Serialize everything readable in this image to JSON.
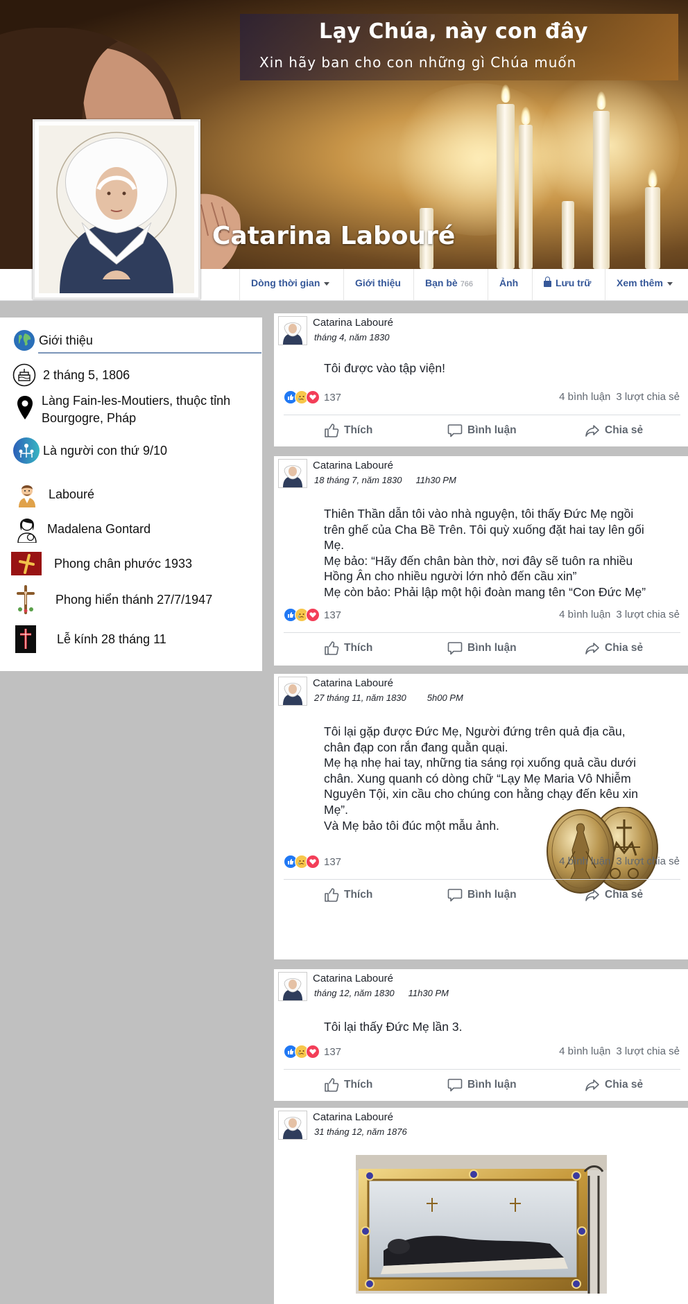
{
  "cover": {
    "title": "Lạy Chúa, này con đây",
    "subtitle": "Xin hãy ban cho con những gì Chúa muốn"
  },
  "profile": {
    "name": "Catarina Labouré"
  },
  "nav": {
    "timeline": "Dòng thời gian",
    "about": "Giới thiệu",
    "friends": "Bạn bè",
    "friends_count": "766",
    "photos": "Ảnh",
    "archive": "Lưu trữ",
    "more": "Xem thêm"
  },
  "intro": {
    "header": "Giới thiệu",
    "birthday": "2 tháng 5, 1806",
    "hometown": "Làng Fain-les-Moutiers, thuộc tỉnh Bourgogre, Pháp",
    "family_order": "Là người con thứ 9/10",
    "father": "Labouré",
    "mother": "Madalena Gontard",
    "beatified": "Phong chân phước 1933",
    "canonized": "Phong hiển thánh 27/7/1947",
    "feast": "Lễ kính 28 tháng 11"
  },
  "actions": {
    "like": "Thích",
    "comment": "Bình luận",
    "share": "Chia sẻ"
  },
  "posts": [
    {
      "author": "Catarina Labouré",
      "date": "tháng 4, năm 1830",
      "lines": [
        "Tôi được vào tập viện!"
      ],
      "reaction_count": "137",
      "comments": "4 bình luận",
      "shares": "3 lượt chia sẻ"
    },
    {
      "author": "Catarina Labouré",
      "date": "18 tháng 7, năm 1830",
      "time": "11h30 PM",
      "lines": [
        "Thiên Thần dẫn tôi vào nhà nguyện,  tôi thấy Đức Mẹ ngồi",
        "trên ghế của Cha Bề Trên. Tôi quỳ xuống đặt hai tay lên gối",
        "Mẹ.",
        "Mẹ bảo: “Hãy đến chân bàn thờ, nơi đây sẽ tuôn ra nhiều",
        "Hồng Ân cho nhiều người lớn nhỏ đến cầu xin”",
        "Mẹ còn bảo: Phải lập một hội đoàn mang tên “Con Đức Mẹ”"
      ],
      "reaction_count": "137",
      "comments": "4 bình luận",
      "shares": "3 lượt chia sẻ"
    },
    {
      "author": "Catarina Labouré",
      "date": "27 tháng 11, năm 1830",
      "time": "5h00 PM",
      "lines": [
        "Tôi lại gặp được Đức Mẹ, Người đứng trên quả địa cầu,",
        "chân đạp con rắn đang quằn quại.",
        "Mẹ hạ nhẹ hai tay, những tia sáng rọi xuống quả cầu dưới",
        "chân. Xung quanh có dòng chữ “Lạy Mẹ Maria Vô Nhiễm",
        "Nguyên Tội, xin cầu cho chúng con hằng chạy đến kêu xin",
        "Mẹ”.",
        "Và Mẹ bảo tôi đúc một mẫu ảnh."
      ],
      "reaction_count": "137",
      "comments": "4 bình luận",
      "shares": "3 lượt chia sẻ"
    },
    {
      "author": "Catarina Labouré",
      "date": "tháng 12, năm 1830",
      "time": "11h30 PM",
      "lines": [
        "Tôi lại thấy Đức Mẹ lần 3."
      ],
      "reaction_count": "137",
      "comments": "4 bình luận",
      "shares": "3 lượt chia sẻ"
    },
    {
      "author": "Catarina Labouré",
      "date": "31 tháng 12, năm 1876"
    }
  ],
  "colors": {
    "link_blue": "#365899",
    "like_blue": "#2078f4",
    "love_red": "#f33e58",
    "sad_yellow": "#f7c64a",
    "page_gray": "#c0c0c0"
  },
  "icons": {
    "birthday": "cake-icon",
    "location": "map-pin-icon",
    "family": "family-tree-icon",
    "father": "man-icon",
    "mother": "woman-with-baby-icon",
    "beatified": "cross-icon",
    "canonized": "crucifix-icon",
    "feast": "red-cross-icon"
  }
}
